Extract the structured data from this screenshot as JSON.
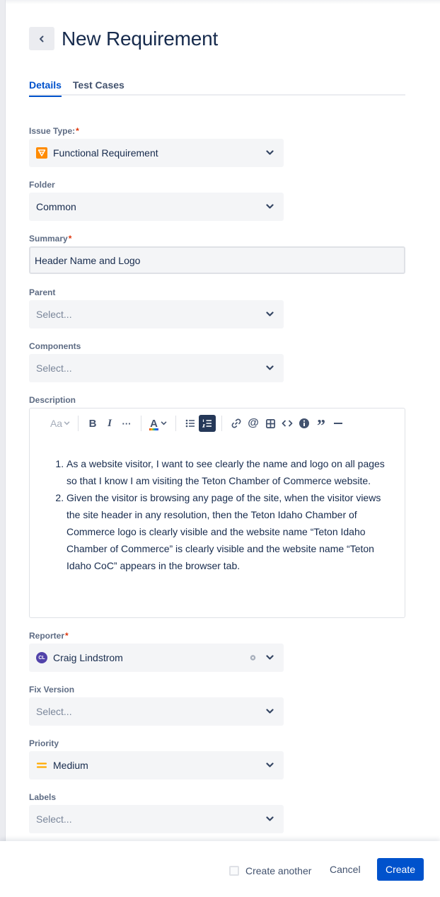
{
  "header": {
    "title": "New Requirement",
    "back_icon": "chevron-left-icon"
  },
  "tabs": [
    {
      "label": "Details",
      "active": true
    },
    {
      "label": "Test Cases",
      "active": false
    }
  ],
  "fields": {
    "issue_type": {
      "label": "Issue Type:",
      "required_mark": "*",
      "value": "Functional Requirement",
      "icon": "functional-requirement-icon"
    },
    "folder": {
      "label": "Folder",
      "value": "Common"
    },
    "summary": {
      "label": "Summary",
      "required_mark": "*",
      "value": "Header Name and Logo"
    },
    "parent": {
      "label": "Parent",
      "placeholder": "Select..."
    },
    "components": {
      "label": "Components",
      "placeholder": "Select..."
    },
    "description": {
      "label": "Description",
      "toolbar": {
        "text_style": "Aa",
        "bold": "B",
        "italic": "I",
        "more": "···",
        "text_color": "A",
        "quote": "”"
      },
      "items": [
        "As a website visitor, I want to see clearly the name and logo on all pages so that I know I am visiting the Teton Chamber of Commerce website.",
        " Given the visitor is browsing any page of the site, when the visitor views the site header in any resolution, then the Teton Idaho Chamber of Commerce logo is clearly visible and the website name “Teton Idaho Chamber of Commerce” is clearly visible and the website name “Teton Idaho CoC” appears in the browser tab."
      ]
    },
    "reporter": {
      "label": "Reporter",
      "required_mark": "*",
      "value": "Craig Lindstrom",
      "avatar_initials": "CL"
    },
    "fix_version": {
      "label": "Fix Version",
      "placeholder": "Select..."
    },
    "priority": {
      "label": "Priority",
      "value": "Medium",
      "icon": "priority-medium-icon"
    },
    "labels": {
      "label": "Labels",
      "placeholder": "Select..."
    }
  },
  "footer": {
    "create_another": "Create another",
    "cancel": "Cancel",
    "create": "Create"
  },
  "colors": {
    "brand_blue": "#0052cc",
    "required_red": "#de350b",
    "field_bg": "#f4f5f7",
    "issue_type_orange": "#ff8b00",
    "priority_orange": "#ffab00",
    "avatar_purple": "#5243aa"
  }
}
